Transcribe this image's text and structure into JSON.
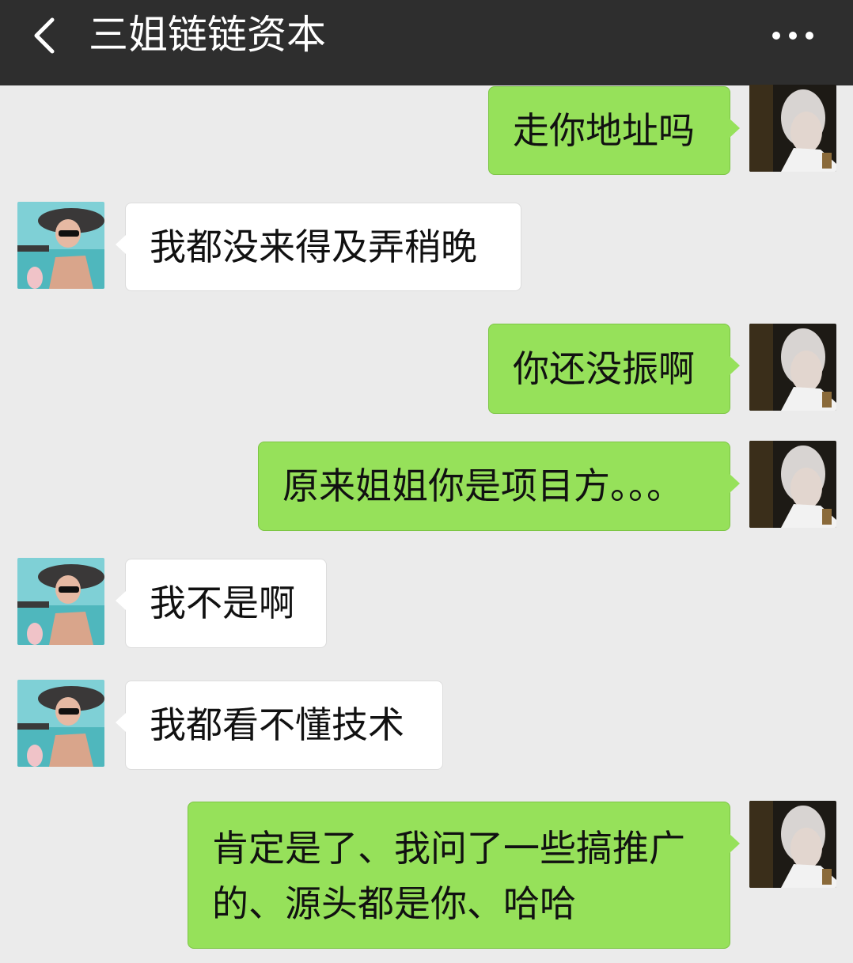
{
  "header": {
    "back_icon": "chevron-left-icon",
    "title": "三姐链链资本",
    "more_icon": "more-dots-icon"
  },
  "messages": [
    {
      "from": "me",
      "text": "走你地址吗"
    },
    {
      "from": "contact",
      "text": "我都没来得及弄稍晚"
    },
    {
      "from": "me",
      "text": "你还没振啊"
    },
    {
      "from": "me",
      "text": "原来姐姐你是项目方。。。"
    },
    {
      "from": "contact",
      "text": "我不是啊"
    },
    {
      "from": "contact",
      "text": "我都看不懂技术"
    },
    {
      "from": "me",
      "text": "肯定是了、我问了一些搞推广的、源头都是你、哈哈"
    }
  ],
  "colors": {
    "header_bg": "#2e2e2e",
    "chat_bg": "#ebebeb",
    "my_bubble": "#96e15a",
    "contact_bubble": "#ffffff"
  }
}
